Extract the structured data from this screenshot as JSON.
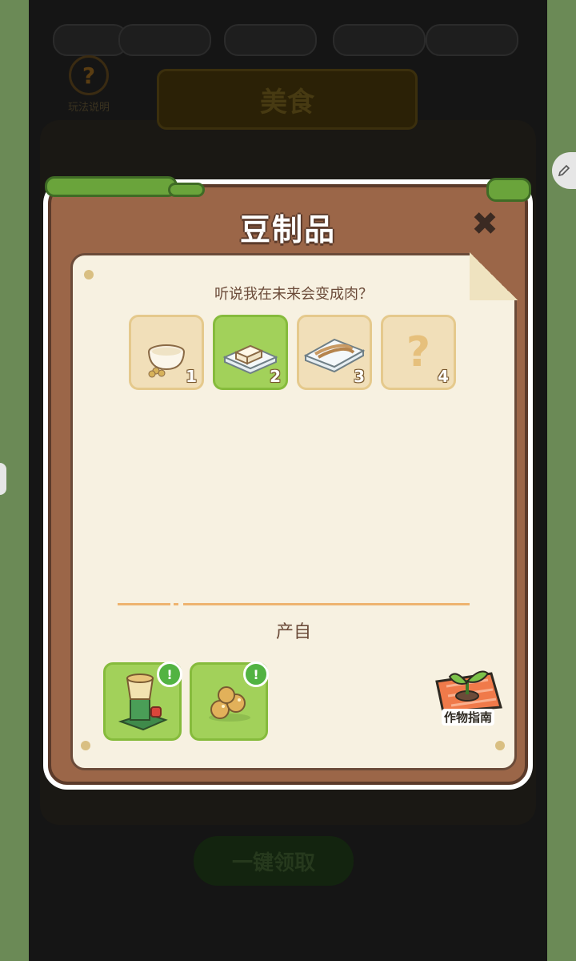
{
  "background": {
    "help_label": "玩法说明",
    "section_title": "美食",
    "claim_all_label": "一键领取"
  },
  "modal": {
    "title": "豆制品",
    "description": "听说我在未来会变成肉？",
    "stages": [
      {
        "num": "1",
        "icon": "soy-milk-icon"
      },
      {
        "num": "2",
        "icon": "tofu-icon"
      },
      {
        "num": "3",
        "icon": "tofu-skin-icon"
      },
      {
        "num": "4",
        "icon": "unknown-icon"
      }
    ],
    "stage_unknown_mark": "?",
    "source_label": "产自",
    "sources": [
      {
        "icon": "soy-grinder-icon",
        "alert": "!"
      },
      {
        "icon": "soybeans-icon",
        "alert": "!"
      }
    ],
    "guide_label": "作物指南"
  },
  "colors": {
    "frame": "#9b6648",
    "paper": "#f7f1e1",
    "active_green": "#a2d15a",
    "stage_tan": "#f1dfb9",
    "accent_orange": "#eeb36f"
  }
}
